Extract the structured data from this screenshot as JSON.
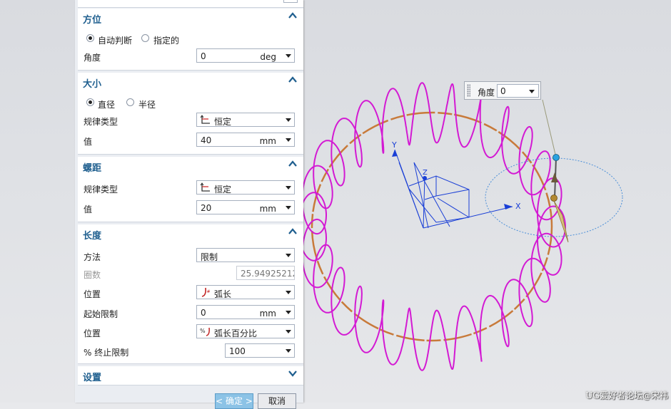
{
  "orientation": {
    "title": "方位",
    "radio_auto": "自动判断",
    "radio_specified": "指定的",
    "angle_label": "角度",
    "angle_value": "0",
    "angle_unit": "deg"
  },
  "size": {
    "title": "大小",
    "radio_diameter": "直径",
    "radio_radius": "半径",
    "law_type_label": "规律类型",
    "law_type_value": "恒定",
    "value_label": "值",
    "value": "40",
    "unit": "mm"
  },
  "pitch": {
    "title": "螺距",
    "law_type_label": "规律类型",
    "law_type_value": "恒定",
    "value_label": "值",
    "value": "20",
    "unit": "mm"
  },
  "length": {
    "title": "长度",
    "method_label": "方法",
    "method_value": "限制",
    "turns_label": "圈数",
    "turns_value": "25.94925212",
    "position1_label": "位置",
    "position1_value": "弧长",
    "start_limit_label": "起始限制",
    "start_limit_value": "0",
    "start_limit_unit": "mm",
    "position2_label": "位置",
    "position2_value": "弧长百分比",
    "end_limit_label": "% 终止限制",
    "end_limit_value": "100"
  },
  "settings": {
    "title": "设置"
  },
  "buttons": {
    "ok": "< 确定 >",
    "cancel": "取消"
  },
  "angle_popup": {
    "label": "角度",
    "value": "0"
  },
  "axes": {
    "x": "X",
    "y": "Y",
    "z": "Z"
  },
  "watermark": "UG爱好者论坛@宋祎",
  "colors": {
    "helix": "#d31ad3",
    "spine": "#c87a3a",
    "axis": "#1a3fd6",
    "section_title": "#1f5f8f",
    "ok_button": "#8cc3e6"
  }
}
